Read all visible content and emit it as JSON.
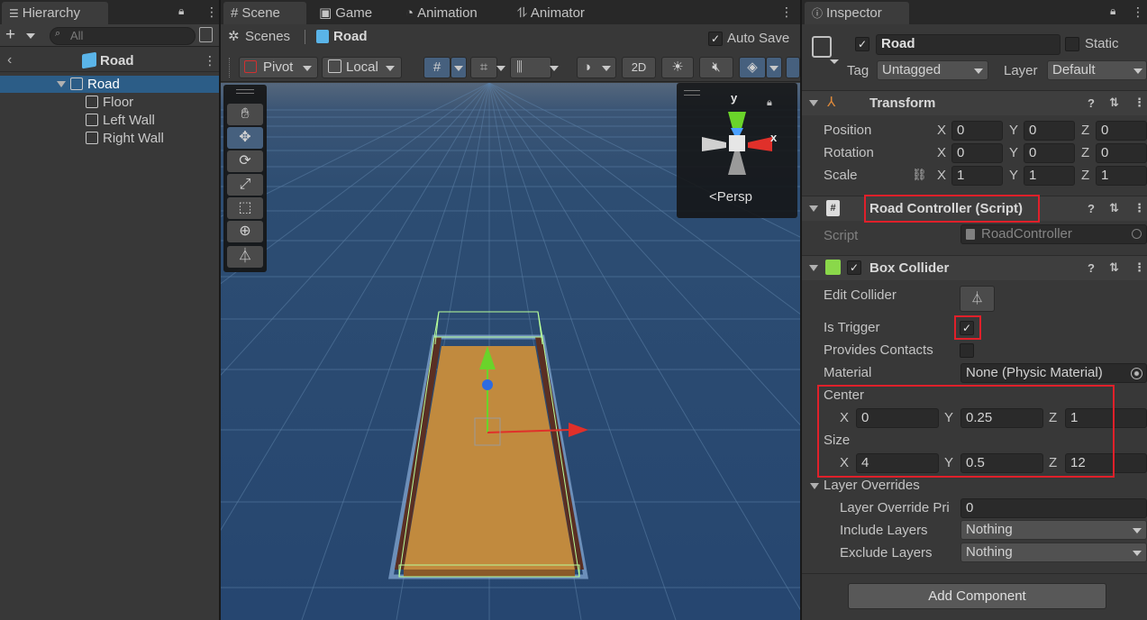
{
  "hierarchy": {
    "tab_label": "Hierarchy",
    "search_placeholder": "All",
    "scene_header": "Road",
    "items": [
      {
        "label": "Road"
      },
      {
        "label": "Floor"
      },
      {
        "label": "Left Wall"
      },
      {
        "label": "Right Wall"
      }
    ]
  },
  "scene": {
    "tabs": [
      "Scene",
      "Game",
      "Animation",
      "Animator"
    ],
    "breadcrumb_root": "Scenes",
    "breadcrumb_current": "Road",
    "auto_save_label": "Auto Save",
    "auto_save_checked": true,
    "pivot_label": "Pivot",
    "local_label": "Local",
    "mode_2d_label": "2D",
    "gizmo_y": "y",
    "gizmo_x": "x",
    "persp_label": "<Persp",
    "colors": {
      "grid_bg": "#26456b",
      "floor": "#c18a3e",
      "wall": "#5a2f23",
      "axis_x": "#e0302a",
      "axis_y": "#6ad42a",
      "axis_z": "#2d6be0"
    }
  },
  "inspector": {
    "tab_label": "Inspector",
    "object_name": "Road",
    "active_checked": true,
    "static_label": "Static",
    "tag_label": "Tag",
    "tag_value": "Untagged",
    "layer_label": "Layer",
    "layer_value": "Default",
    "transform": {
      "title": "Transform",
      "rows": [
        {
          "label": "Position",
          "x": "0",
          "y": "0",
          "z": "0"
        },
        {
          "label": "Rotation",
          "x": "0",
          "y": "0",
          "z": "0"
        },
        {
          "label": "Scale",
          "x": "1",
          "y": "1",
          "z": "1"
        }
      ],
      "axis_x": "X",
      "axis_y": "Y",
      "axis_z": "Z"
    },
    "road_controller": {
      "title": "Road Controller (Script)",
      "script_label": "Script",
      "script_value": "RoadController"
    },
    "box_collider": {
      "title": "Box Collider",
      "enabled": true,
      "edit_collider_label": "Edit Collider",
      "is_trigger_label": "Is Trigger",
      "is_trigger_checked": true,
      "provides_contacts_label": "Provides Contacts",
      "material_label": "Material",
      "material_value": "None (Physic Material)",
      "center_label": "Center",
      "center": {
        "x": "0",
        "y": "0.25",
        "z": "1"
      },
      "size_label": "Size",
      "size": {
        "x": "4",
        "y": "0.5",
        "z": "12"
      },
      "layer_overrides_label": "Layer Overrides",
      "layer_override_priority_label": "Layer Override Pri",
      "layer_override_priority_value": "0",
      "include_layers_label": "Include Layers",
      "include_layers_value": "Nothing",
      "exclude_layers_label": "Exclude Layers",
      "exclude_layers_value": "Nothing"
    },
    "add_component_label": "Add Component"
  }
}
